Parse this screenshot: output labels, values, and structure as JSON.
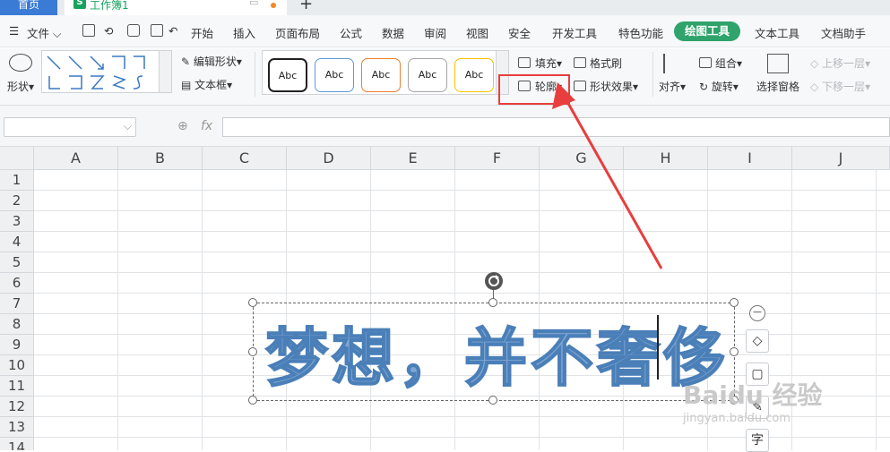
{
  "tabs": {
    "home": "首页",
    "workbook": "工作簿1",
    "workbook_icon": "S",
    "new": "+"
  },
  "menu": {
    "file": "文件",
    "items": [
      "开始",
      "插入",
      "页面布局",
      "公式",
      "数据",
      "审阅",
      "视图",
      "安全",
      "开发工具",
      "特色功能"
    ],
    "active": "绘图工具",
    "after": [
      "文本工具",
      "文档助手"
    ]
  },
  "ribbon": {
    "shape": "形状",
    "edit_shape": "编辑形状",
    "textbox": "文本框",
    "style_samples": [
      "Abc",
      "Abc",
      "Abc",
      "Abc",
      "Abc"
    ],
    "style_colors": [
      "#222222",
      "#5b9bd5",
      "#ed7d31",
      "#a5a5a5",
      "#ffc000"
    ],
    "fill": "填充",
    "format_painter": "格式刷",
    "outline": "轮廓",
    "shape_effect": "形状效果",
    "align": "对齐",
    "group": "组合",
    "rotate": "旋转",
    "selection_pane": "选择窗格",
    "bring_forward": "上移一层",
    "send_backward": "下移一层"
  },
  "formula": {
    "fx": "fx"
  },
  "columns": [
    "A",
    "B",
    "C",
    "D",
    "E",
    "F",
    "G",
    "H",
    "I",
    "J"
  ],
  "rows": [
    "1",
    "2",
    "3",
    "4",
    "5",
    "6",
    "7",
    "8",
    "9",
    "10",
    "11",
    "12",
    "13",
    "14"
  ],
  "textbox": {
    "content": "梦想，并不奢侈"
  },
  "float_tools": [
    "◇",
    "▢",
    "✎",
    "字"
  ],
  "watermark": {
    "main": "Baidu 经验",
    "sub": "jingyan.baidu.com"
  },
  "colors": {
    "accent": "#2fa36b",
    "highlight": "#e83e3e",
    "tab_blue": "#3a7bd5",
    "art_fill": "#7fa6d2"
  }
}
